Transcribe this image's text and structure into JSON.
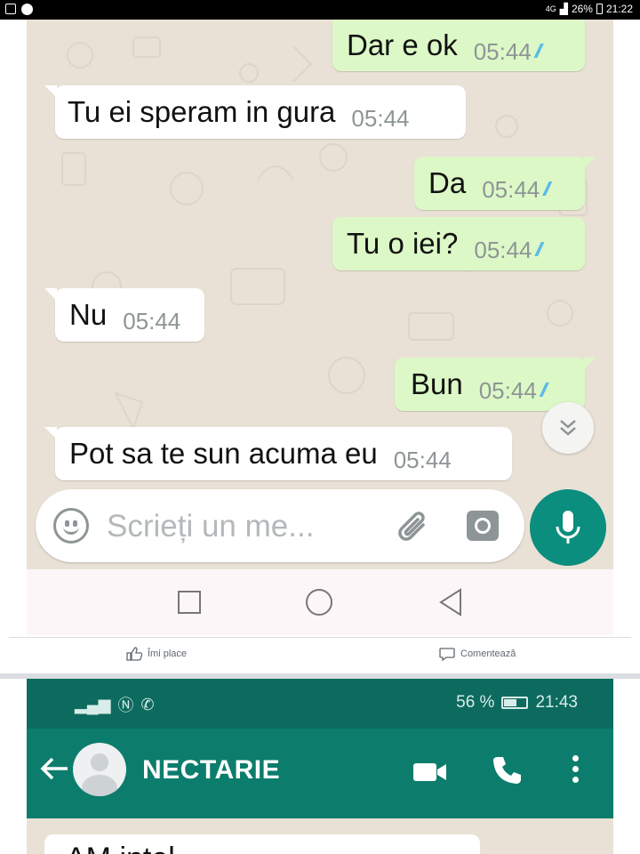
{
  "status_bar": {
    "signal": "4G",
    "battery": "26%",
    "time": "21:22"
  },
  "chat": {
    "messages": [
      {
        "dir": "out",
        "text": "Dar e ok",
        "time": "05:44",
        "ticks": "//"
      },
      {
        "dir": "in",
        "text": "Tu ei speram in gura",
        "time": "05:44"
      },
      {
        "dir": "out",
        "text": "Da",
        "time": "05:44",
        "ticks": "//"
      },
      {
        "dir": "out",
        "text": "Tu o iei?",
        "time": "05:44",
        "ticks": "//"
      },
      {
        "dir": "in",
        "text": "Nu",
        "time": "05:44"
      },
      {
        "dir": "out",
        "text": "Bun",
        "time": "05:44",
        "ticks": "//"
      },
      {
        "dir": "in",
        "text": "Pot sa te sun acuma eu",
        "time": "05:44"
      }
    ],
    "composer_placeholder": "Scrieți un me..."
  },
  "facebook": {
    "like_label": "Îmi place",
    "comment_label": "Comentează"
  },
  "second_screen": {
    "status_battery": "56 %",
    "status_time": "21:43",
    "contact_name": "NECTARIE",
    "partial_message": "AM intel..."
  },
  "colors": {
    "accent": "#0b8e7d",
    "header": "#0c7d6c",
    "outgoing": "#dcf8c6",
    "incoming": "#ffffff",
    "ticks": "#4fb6ec"
  }
}
